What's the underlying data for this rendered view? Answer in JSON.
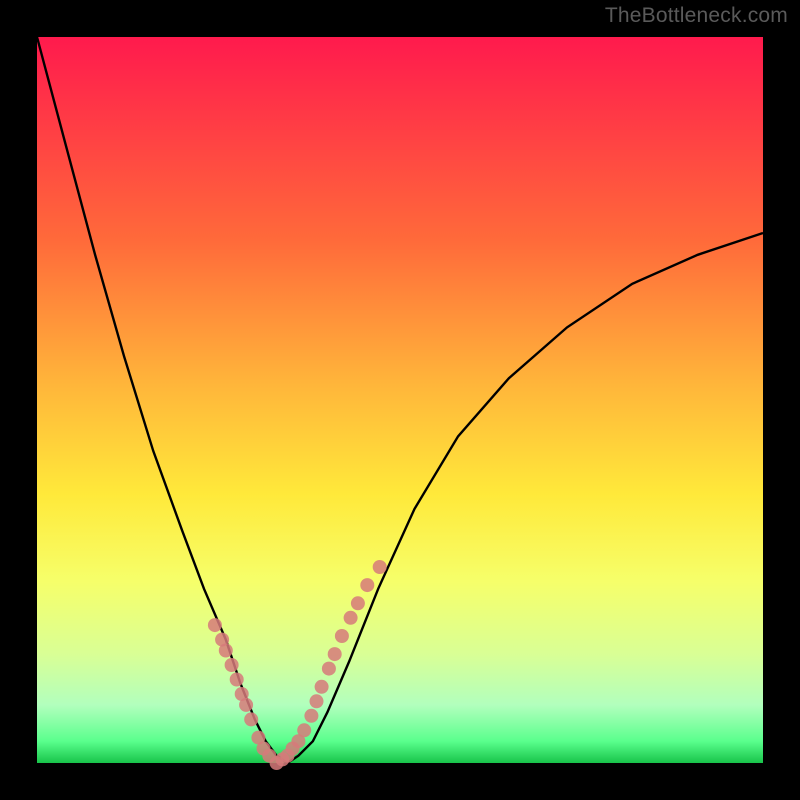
{
  "watermark": "TheBottleneck.com",
  "chart_data": {
    "type": "line",
    "title": "",
    "xlabel": "",
    "ylabel": "",
    "ylim": [
      0,
      100
    ],
    "xlim": [
      0,
      100
    ],
    "series": [
      {
        "name": "bottleneck-curve",
        "x": [
          0,
          4,
          8,
          12,
          16,
          20,
          23,
          26,
          28,
          30,
          31.5,
          33,
          34.5,
          36,
          38,
          40,
          43,
          47,
          52,
          58,
          65,
          73,
          82,
          91,
          100
        ],
        "y": [
          100,
          85,
          70,
          56,
          43,
          32,
          24,
          17,
          11,
          6,
          3,
          1,
          0,
          1,
          3,
          7,
          14,
          24,
          35,
          45,
          53,
          60,
          66,
          70,
          73
        ]
      }
    ],
    "markers": {
      "name": "highlighted-points",
      "color": "#d67a7a",
      "x": [
        24.5,
        25.5,
        26,
        26.8,
        27.5,
        28.2,
        28.8,
        29.5,
        30.5,
        31.2,
        32,
        33,
        33.8,
        34.5,
        35.2,
        36,
        36.8,
        37.8,
        38.5,
        39.2,
        40.2,
        41,
        42,
        43.2,
        44.2,
        45.5,
        47.2
      ],
      "y": [
        19,
        17,
        15.5,
        13.5,
        11.5,
        9.5,
        8,
        6,
        3.5,
        2,
        1,
        0,
        0.5,
        1,
        2,
        3,
        4.5,
        6.5,
        8.5,
        10.5,
        13,
        15,
        17.5,
        20,
        22,
        24.5,
        27
      ]
    },
    "gradient_stops": [
      {
        "pos": 0,
        "color": "#ff1a4d"
      },
      {
        "pos": 28,
        "color": "#ff6a3a"
      },
      {
        "pos": 48,
        "color": "#ffb63a"
      },
      {
        "pos": 63,
        "color": "#ffe93a"
      },
      {
        "pos": 75,
        "color": "#f6ff6a"
      },
      {
        "pos": 85,
        "color": "#d9ff95"
      },
      {
        "pos": 92,
        "color": "#b2ffbd"
      },
      {
        "pos": 97,
        "color": "#5aff8d"
      },
      {
        "pos": 100,
        "color": "#18c44a"
      }
    ]
  }
}
